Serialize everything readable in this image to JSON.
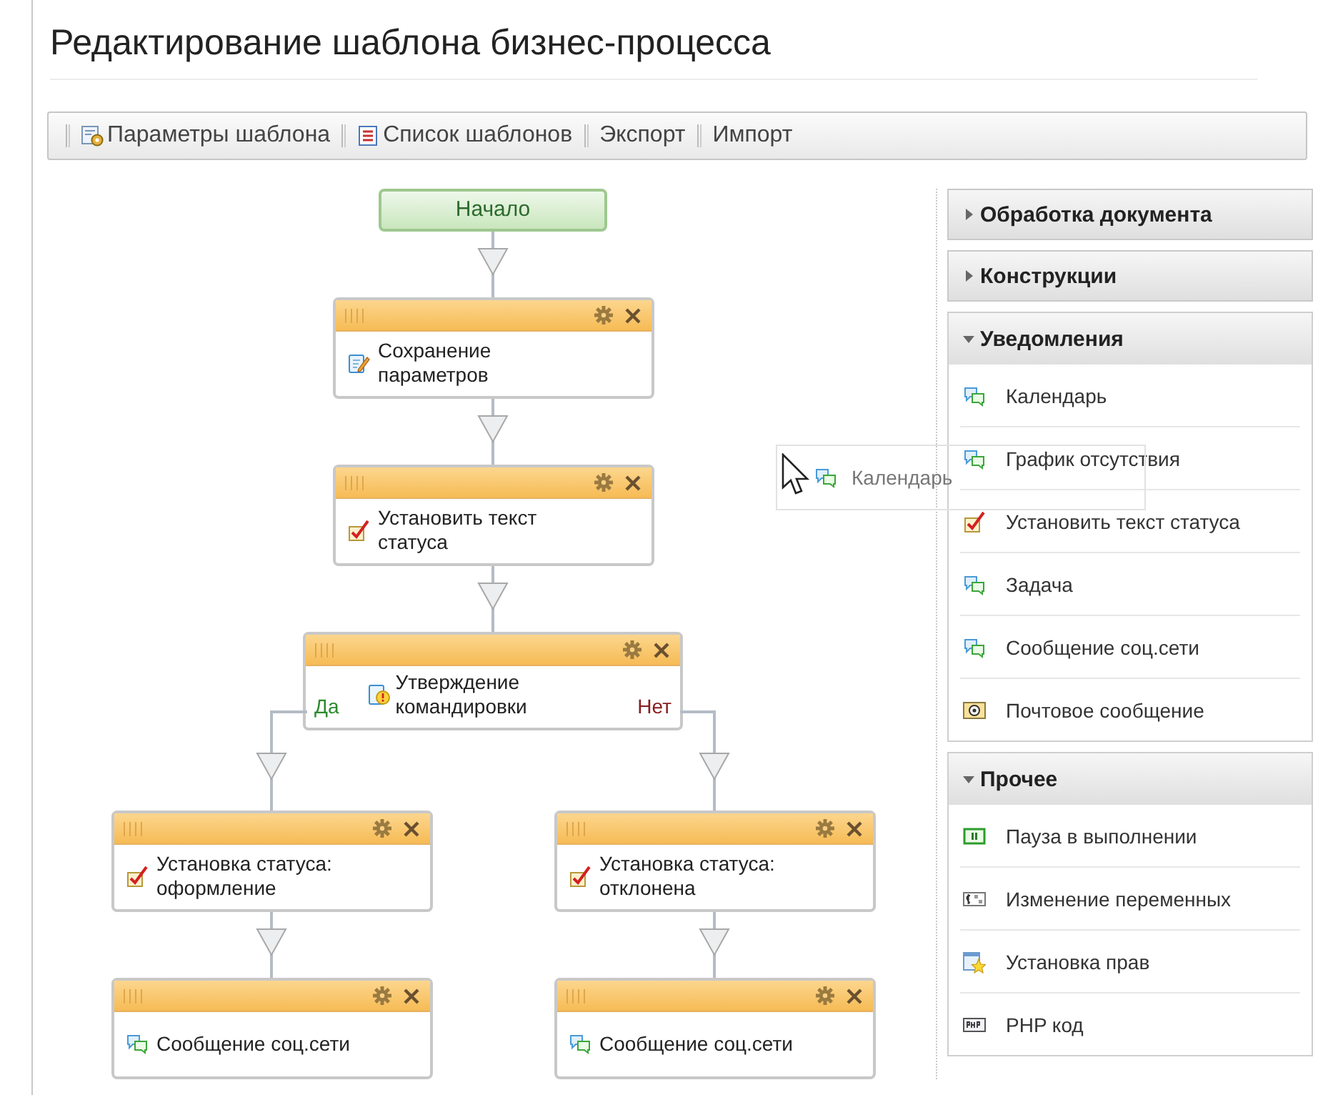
{
  "page_title": "Редактирование шаблона бизнес-процесса",
  "toolbar": [
    {
      "label": "Параметры шаблона",
      "kind": "settings"
    },
    {
      "label": "Список шаблонов",
      "kind": "list"
    },
    {
      "label": "Экспорт"
    },
    {
      "label": "Импорт"
    }
  ],
  "process": {
    "start": "Начало",
    "steps": [
      {
        "kind": "edit",
        "label": "Сохранение параметров"
      },
      {
        "kind": "status",
        "label": "Установить текст статуса"
      },
      {
        "kind": "approve",
        "label": "Утверждение командировки",
        "yes_label": "Да",
        "no_label": "Нет",
        "branches": [
          {
            "steps": [
              {
                "kind": "status",
                "label": "Установка статуса: оформление"
              },
              {
                "kind": "chat",
                "label": "Сообщение соц.сети"
              }
            ]
          },
          {
            "steps": [
              {
                "kind": "status",
                "label": "Установка статуса: отклонена"
              },
              {
                "kind": "chat",
                "label": "Сообщение соц.сети"
              }
            ]
          }
        ]
      }
    ]
  },
  "palette": [
    {
      "title": "Обработка документа",
      "expanded": false
    },
    {
      "title": "Конструкции",
      "expanded": false
    },
    {
      "title": "Уведомления",
      "expanded": true,
      "items": [
        {
          "label": "Календарь",
          "kind": "chat"
        },
        {
          "label": "График отсутствия",
          "kind": "chat"
        },
        {
          "label": "Установить текст статуса",
          "kind": "status"
        },
        {
          "label": "Задача",
          "kind": "chat"
        },
        {
          "label": "Сообщение соц.сети",
          "kind": "chat"
        },
        {
          "label": "Почтовое сообщение",
          "kind": "mail"
        }
      ]
    },
    {
      "title": "Прочее",
      "expanded": true,
      "items": [
        {
          "label": "Пауза в выполнении",
          "kind": "pause"
        },
        {
          "label": "Изменение переменных",
          "kind": "vars"
        },
        {
          "label": "Установка прав",
          "kind": "rights"
        },
        {
          "label": "PHP код",
          "kind": "php"
        }
      ]
    }
  ],
  "drag_preview": {
    "label": "Календарь",
    "kind": "chat"
  }
}
